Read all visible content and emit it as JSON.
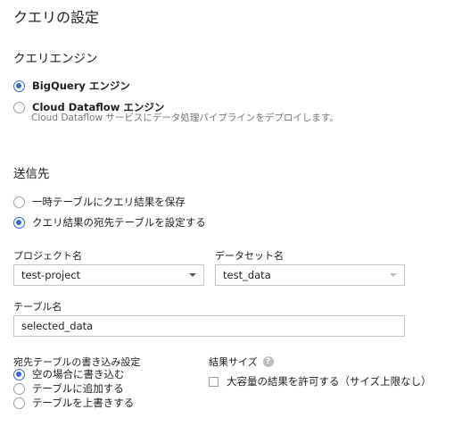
{
  "page": {
    "title": "クエリの設定"
  },
  "query_engine": {
    "heading": "クエリエンジン",
    "options": [
      {
        "label": "BigQuery エンジン",
        "checked": true
      },
      {
        "label": "Cloud Dataflow エンジン",
        "description": "Cloud Dataflow サービスにデータ処理パイプラインをデプロイします。",
        "checked": false
      }
    ]
  },
  "destination": {
    "heading": "送信先",
    "options": [
      {
        "label": "一時テーブルにクエリ結果を保存",
        "checked": false
      },
      {
        "label": "クエリ結果の宛先テーブルを設定する",
        "checked": true
      }
    ],
    "project": {
      "label": "プロジェクト名",
      "value": "test-project"
    },
    "dataset": {
      "label": "データセット名",
      "value": "test_data"
    },
    "table": {
      "label": "テーブル名",
      "value": "selected_data"
    }
  },
  "write_preference": {
    "heading": "宛先テーブルの書き込み設定",
    "options": [
      {
        "label": "空の場合に書き込む",
        "checked": true
      },
      {
        "label": "テーブルに追加する",
        "checked": false
      },
      {
        "label": "テーブルを上書きする",
        "checked": false
      }
    ]
  },
  "result_size": {
    "heading": "結果サイズ",
    "help_icon": "?",
    "checkbox_label": "大容量の結果を許可する（サイズ上限なし）",
    "checked": false
  },
  "colors": {
    "accent": "#3367d6"
  }
}
